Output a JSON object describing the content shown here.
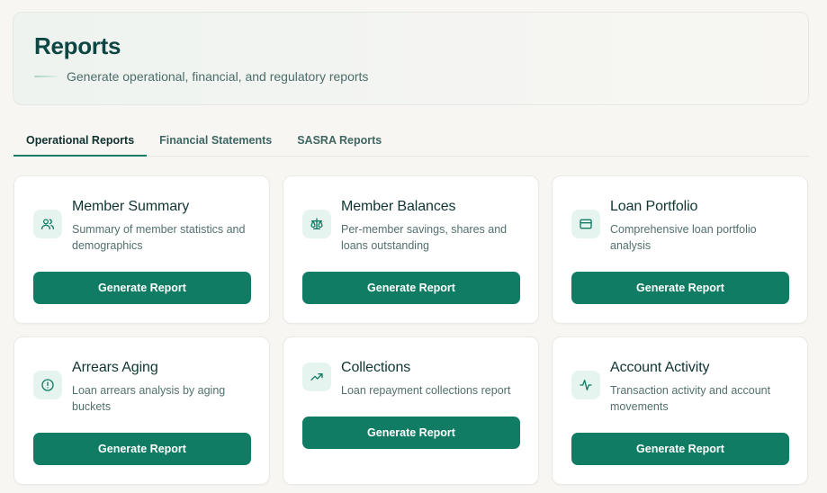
{
  "header": {
    "title": "Reports",
    "subtitle": "Generate operational, financial, and regulatory reports"
  },
  "tabs": [
    {
      "label": "Operational Reports",
      "active": true
    },
    {
      "label": "Financial Statements",
      "active": false
    },
    {
      "label": "SASRA Reports",
      "active": false
    }
  ],
  "reports": [
    {
      "title": "Member Summary",
      "description": "Summary of member statistics and demographics",
      "icon": "users-icon",
      "button": "Generate Report"
    },
    {
      "title": "Member Balances",
      "description": "Per-member savings, shares and loans outstanding",
      "icon": "scale-icon",
      "button": "Generate Report"
    },
    {
      "title": "Loan Portfolio",
      "description": "Comprehensive loan portfolio analysis",
      "icon": "credit-card-icon",
      "button": "Generate Report"
    },
    {
      "title": "Arrears Aging",
      "description": "Loan arrears analysis by aging buckets",
      "icon": "alert-circle-icon",
      "button": "Generate Report"
    },
    {
      "title": "Collections",
      "description": "Loan repayment collections report",
      "icon": "trending-up-icon",
      "button": "Generate Report"
    },
    {
      "title": "Account Activity",
      "description": "Transaction activity and account movements",
      "icon": "activity-icon",
      "button": "Generate Report"
    }
  ],
  "colors": {
    "primary": "#0f7c63",
    "icon_bg": "#e6f4ef",
    "title": "#0d4643"
  }
}
